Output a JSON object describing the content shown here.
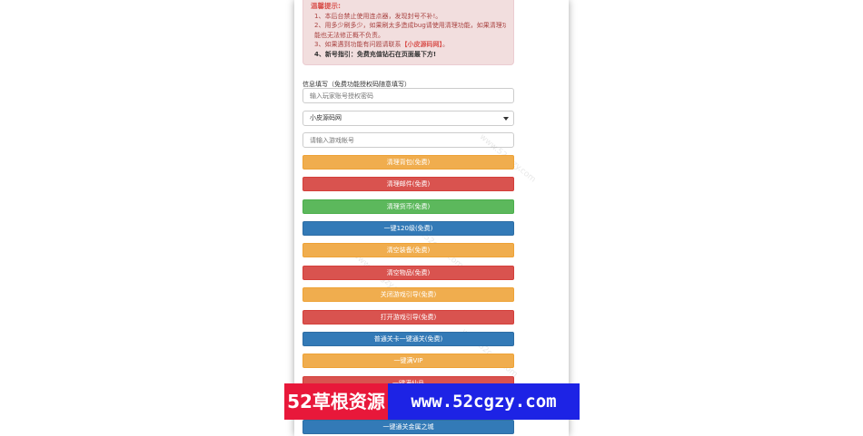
{
  "notice": {
    "title": "温馨提示:",
    "line1": "1、本后台禁止使用连点器，发现封号不补!。",
    "line2a": "2、用多少刷多少，如果刷太多造成bug请使用清理功能，如果清理功",
    "line2b": "能也无法修正概不负责。",
    "line3_prefix": "3、如果遇到功能有问题请联系",
    "line3_highlight": "【小皮源码网】",
    "line3_suffix": "。",
    "line4": "4、新号指引：免费充值钻石在页面最下方!"
  },
  "form": {
    "label": "信息填写（免费功能授权码随意填写）",
    "auth_placeholder": "输入玩家账号授权密码",
    "server_selected": "小皮源码网",
    "account_placeholder": "请输入游戏帐号"
  },
  "buttons": [
    {
      "label": "清理背包(免费)",
      "color": "#f0ad4e"
    },
    {
      "label": "清理邮件(免费)",
      "color": "#d9534f"
    },
    {
      "label": "清理货币(免费)",
      "color": "#5cb85c"
    },
    {
      "label": "一键120级(免费)",
      "color": "#337ab7"
    },
    {
      "label": "清空装备(免费)",
      "color": "#f0ad4e"
    },
    {
      "label": "清空物品(免费)",
      "color": "#d9534f"
    },
    {
      "label": "关闭游戏引导(免费)",
      "color": "#f0ad4e"
    },
    {
      "label": "打开游戏引导(免费)",
      "color": "#d9534f"
    },
    {
      "label": "普通关卡一键通关(免费)",
      "color": "#337ab7"
    },
    {
      "label": "一键满VIP",
      "color": "#f0ad4e"
    },
    {
      "label": "一键满仙品",
      "color": "#d9534f"
    },
    {
      "label": "一键通关金属之城",
      "color": "#337ab7"
    }
  ],
  "banner": {
    "left_text": "52草根资源",
    "right_text": "www.52cgzy.com"
  },
  "watermark": "www.52cgzy.com"
}
